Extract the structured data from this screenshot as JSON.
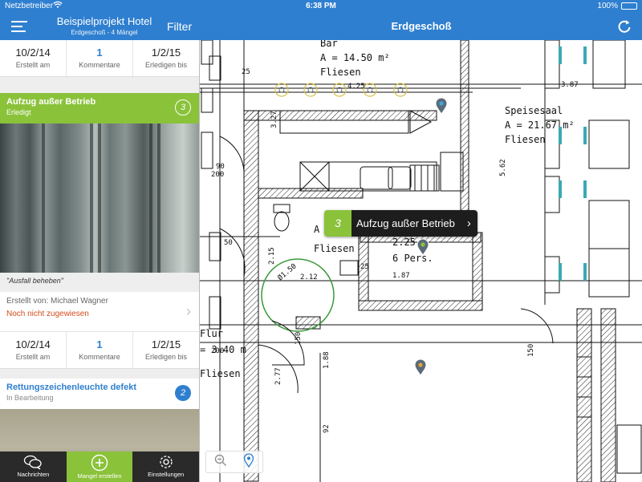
{
  "status_bar": {
    "carrier": "Netzbetreiber",
    "time": "6:38 PM",
    "battery": "100%"
  },
  "navbar": {
    "project_title": "Beispielprojekt Hotel",
    "project_subtitle": "Erdgeschoß - 4 Mängel",
    "filter_label": "Filter",
    "plan_title": "Erdgeschoß"
  },
  "top_stats": [
    {
      "value": "10/2/14",
      "label": "Erstellt am"
    },
    {
      "value": "1",
      "label": "Kommentare"
    },
    {
      "value": "1/2/15",
      "label": "Erledigen bis"
    }
  ],
  "defect1": {
    "title": "Aufzug außer Betrieb",
    "status": "Erledigt",
    "number": "3",
    "quote": "\"Ausfall beheben\"",
    "created_by": "Erstellt von: Michael Wagner",
    "assignment": "Noch nicht zugewiesen",
    "stats": [
      {
        "value": "10/2/14",
        "label": "Erstellt am"
      },
      {
        "value": "1",
        "label": "Kommentare"
      },
      {
        "value": "1/2/15",
        "label": "Erledigen bis"
      }
    ]
  },
  "defect2": {
    "title": "Rettungszeichenleuchte defekt",
    "status": "In Bearbeitung",
    "number": "2"
  },
  "tabbar": {
    "messages": "Nachrichten",
    "create": "Mangel erstellen",
    "settings": "Einstellungen"
  },
  "callout": {
    "number": "3",
    "text": "Aufzug außer Betrieb"
  },
  "plan_labels": {
    "room1_name": "Bar",
    "room1_area": "A = 14.50 m²",
    "room1_floor": "Fliesen",
    "room2_name": "Speisesaal",
    "room2_area": "A = 21.67 m²",
    "room2_floor": "Fliesen",
    "room3_area": "A",
    "room3_floor": "Fliesen",
    "elevator_size": "2.25",
    "elevator_people": "6 Pers.",
    "hall_name": "Flur",
    "hall_area": "= 3.40 m",
    "hall_floor": "Fliesen",
    "dim_425": "4.25",
    "dim_387": "3.87",
    "dim_327": "3.27",
    "dim_562": "5.62",
    "dim_187": "1.87",
    "dim_188": "1.88",
    "dim_277": "2.77",
    "dim_925": "92",
    "dim_050": "50",
    "dim_90": "90",
    "dim_200": "200",
    "dim_150": "150",
    "dim_215": "2.15",
    "dim_212": "2.12",
    "dim_d150": "Ø1.50",
    "dim_25": "25"
  },
  "colors": {
    "accent_blue": "#2f7fd0",
    "accent_green": "#8ac23a",
    "warning_orange": "#d24d1d",
    "marker_teal": "#3aa9b5"
  }
}
